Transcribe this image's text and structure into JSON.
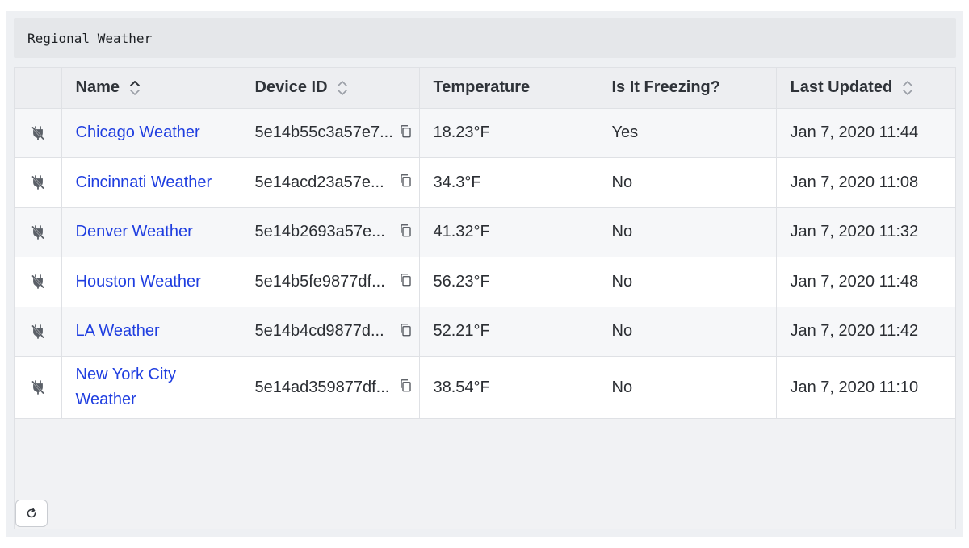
{
  "panel": {
    "title": "Regional Weather"
  },
  "table": {
    "columns": [
      {
        "label": "",
        "sortable": false
      },
      {
        "label": "Name",
        "sortable": true,
        "sort": "asc"
      },
      {
        "label": "Device ID",
        "sortable": true,
        "sort": "none"
      },
      {
        "label": "Temperature",
        "sortable": false
      },
      {
        "label": "Is It Freezing?",
        "sortable": false
      },
      {
        "label": "Last Updated",
        "sortable": true,
        "sort": "none"
      }
    ],
    "rows": [
      {
        "name": "Chicago Weather",
        "device_id": "5e14b55c3a57e7...",
        "temperature": "18.23°F",
        "freezing": "Yes",
        "updated": "Jan 7, 2020 11:44"
      },
      {
        "name": "Cincinnati Weather",
        "device_id": "5e14acd23a57e...",
        "temperature": "34.3°F",
        "freezing": "No",
        "updated": "Jan 7, 2020 11:08"
      },
      {
        "name": "Denver Weather",
        "device_id": "5e14b2693a57e...",
        "temperature": "41.32°F",
        "freezing": "No",
        "updated": "Jan 7, 2020 11:32"
      },
      {
        "name": "Houston Weather",
        "device_id": "5e14b5fe9877df...",
        "temperature": "56.23°F",
        "freezing": "No",
        "updated": "Jan 7, 2020 11:48"
      },
      {
        "name": "LA Weather",
        "device_id": "5e14b4cd9877d...",
        "temperature": "52.21°F",
        "freezing": "No",
        "updated": "Jan 7, 2020 11:42"
      },
      {
        "name": "New York City Weather",
        "device_id": "5e14ad359877df...",
        "temperature": "38.54°F",
        "freezing": "No",
        "updated": "Jan 7, 2020 11:10"
      }
    ]
  },
  "icons": {
    "row_icon": "plug-icon",
    "copy": "copy-icon",
    "sort": "sort-icon",
    "refresh": "refresh-icon"
  },
  "colors": {
    "link": "#1f3ee0",
    "panel_bg": "#eef0f3",
    "header_bg": "#e5e7ea"
  }
}
